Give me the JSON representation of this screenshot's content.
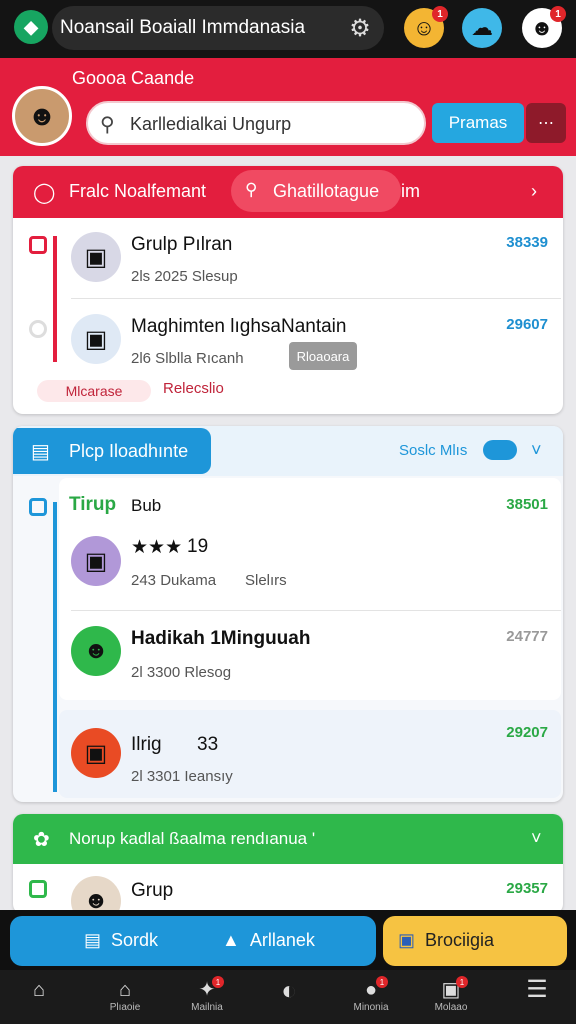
{
  "app": {
    "title": "Noansail Boaiall Immdanasia"
  },
  "header": {
    "user_name": "Goooa Caande",
    "search_value": "Karlledialkai Ungurp",
    "primary_label": "Pramas"
  },
  "top_badges": [
    "1",
    "1"
  ],
  "section1": {
    "title": "Fralc Noalfemant",
    "chip_label": "Ghatillotague",
    "extra": "im",
    "groups": [
      {
        "name": "Grulp Pılran",
        "meta": "2ls 2025 Slesup",
        "count": "38339"
      },
      {
        "name": "Maghimten lıghsaNantain",
        "meta": "2l6 Slblla Rıcanh",
        "tag": "Rloaoara",
        "count": "29607"
      }
    ],
    "chip_a": "Mlcarase",
    "chip_b": "Relecslio"
  },
  "section2": {
    "title": "Plcp Iloadhınte",
    "side_link": "Soslc Mlıs",
    "groups": [
      {
        "name": "Tirup",
        "name_suffix": "Bub",
        "count": "38501"
      },
      {
        "name": "19",
        "meta_a": "243 Dukama",
        "meta_b": "Slelırs"
      },
      {
        "name": "Hadikah 1Minguuah",
        "meta": "2l 3300 Rlesog",
        "count": "24777"
      },
      {
        "name": "Ilrig",
        "name_num": "33",
        "meta": "2l 3301 Ieansıy",
        "count": "29207"
      }
    ]
  },
  "section3": {
    "title": "Norup kadlal ßaalma rendıanua '",
    "groups": [
      {
        "name": "Grup",
        "count": "29357"
      }
    ]
  },
  "action_bar": {
    "left_a": "Sordk",
    "left_b": "Arllanek",
    "right": "Brociigia"
  },
  "nav": {
    "items": [
      {
        "label": ""
      },
      {
        "label": "Plıaoie"
      },
      {
        "label": "Mailnia"
      },
      {
        "label": ""
      },
      {
        "label": "Minonia"
      },
      {
        "label": "Molaao"
      },
      {
        "label": ""
      }
    ],
    "badges": [
      "1",
      "1",
      "1",
      "1"
    ]
  },
  "colors": {
    "red": "#e31e3e",
    "blue": "#1e96d9",
    "green": "#2fb84b",
    "yellow": "#f6c342",
    "count_blue": "#1e8fd0",
    "count_green": "#2aa845"
  },
  "icons": [
    "logo-icon",
    "gear-icon",
    "search-icon",
    "shield-icon",
    "inbox-icon",
    "leaf-icon",
    "chevron-right-icon",
    "chevron-down-icon",
    "home-icon",
    "menu-icon"
  ]
}
